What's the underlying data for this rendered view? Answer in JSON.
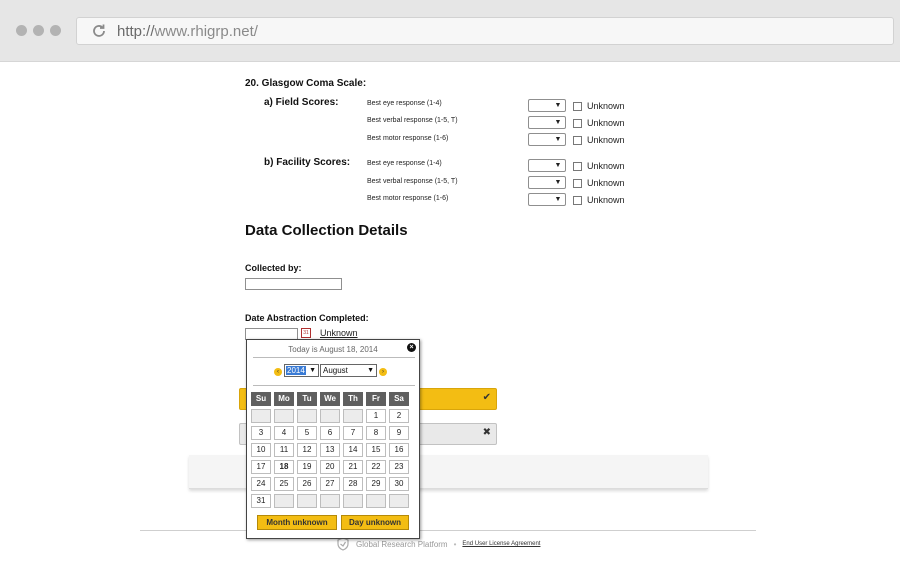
{
  "browser": {
    "url_scheme": "http://",
    "url_host": "www.rhigrp.net/"
  },
  "gcs": {
    "title": "20.  Glasgow Coma Scale:",
    "field": {
      "label": "a) Field Scores:",
      "rows": [
        {
          "label": "Best eye response (1-4)",
          "unknown": "Unknown"
        },
        {
          "label": "Best verbal response (1-5, T)",
          "unknown": "Unknown"
        },
        {
          "label": "Best motor response (1-6)",
          "unknown": "Unknown"
        }
      ]
    },
    "facility": {
      "label": "b) Facility Scores:",
      "rows": [
        {
          "label": "Best eye response (1-4)",
          "unknown": "Unknown"
        },
        {
          "label": "Best verbal response (1-5, T)",
          "unknown": "Unknown"
        },
        {
          "label": "Best motor response (1-6)",
          "unknown": "Unknown"
        }
      ]
    }
  },
  "dcd": {
    "heading": "Data Collection Details",
    "collected_by_label": "Collected by:",
    "date_label": "Date Abstraction Completed:",
    "unknown_link": "Unknown",
    "calendar_icon": "calendar-icon",
    "calendar_icon_text": "31"
  },
  "datepicker": {
    "today_text": "Today is August 18, 2014",
    "year": "2014",
    "month": "August",
    "weekdays": [
      "Su",
      "Mo",
      "Tu",
      "We",
      "Th",
      "Fr",
      "Sa"
    ],
    "weeks": [
      [
        "",
        "",
        "",
        "",
        "",
        "1",
        "2"
      ],
      [
        "3",
        "4",
        "5",
        "6",
        "7",
        "8",
        "9"
      ],
      [
        "10",
        "11",
        "12",
        "13",
        "14",
        "15",
        "16"
      ],
      [
        "17",
        "18",
        "19",
        "20",
        "21",
        "22",
        "23"
      ],
      [
        "24",
        "25",
        "26",
        "27",
        "28",
        "29",
        "30"
      ],
      [
        "31",
        "",
        "",
        "",
        "",
        "",
        ""
      ]
    ],
    "today_day": "18",
    "month_unknown": "Month unknown",
    "day_unknown": "Day unknown"
  },
  "footer": {
    "brand": "Global Research Platform",
    "separator": "•",
    "eula": "End User License Agreement"
  },
  "colors": {
    "accent": "#f3bd13",
    "header_dark": "#5f5f5f"
  }
}
